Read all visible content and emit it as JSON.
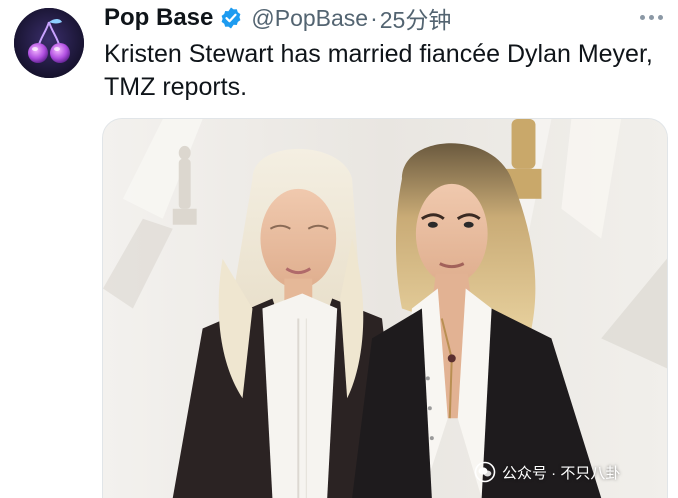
{
  "tweet": {
    "display_name": "Pop Base",
    "handle": "@PopBase",
    "separator": "·",
    "time": "25分钟",
    "text": "Kristen Stewart has married fiancée Dylan Meyer, TMZ reports.",
    "avatar_icon": "cherry-logo-icon",
    "verified_icon": "verified-badge-icon",
    "more_icon": "more-options-icon",
    "media_alt": "photo"
  },
  "watermark": {
    "icon": "wechat-logo-icon",
    "text": "公众号 · 不只八卦"
  },
  "colors": {
    "verified_blue": "#1d9bf0",
    "secondary_text": "#536471",
    "primary_text": "#0f1419"
  }
}
